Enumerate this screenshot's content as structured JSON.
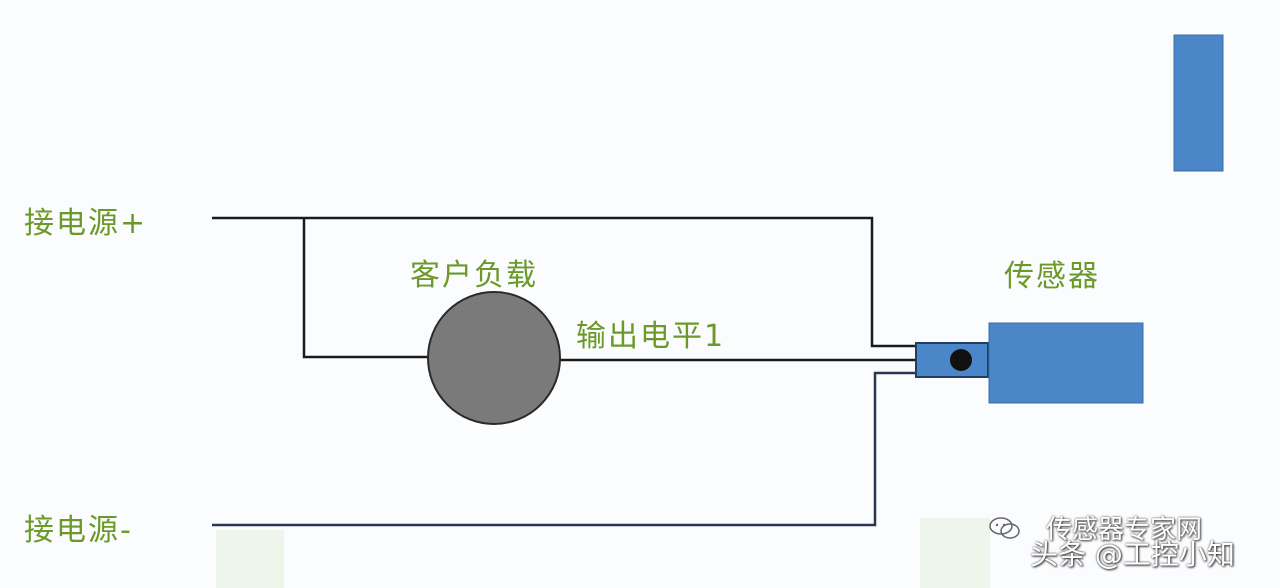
{
  "labels": {
    "power_plus": "接电源+",
    "power_minus": "接电源-",
    "customer_load": "客户负载",
    "output_level": "输出电平1",
    "sensor": "传感器"
  },
  "watermark": {
    "source": "传感器专家网",
    "author": "头条 @工控小知",
    "icon": "wechat-icon"
  },
  "colors": {
    "label_text": "#6b9a2a",
    "wire": "#1a1a1a",
    "wire_blue": "#2d6fb5",
    "sensor_fill": "#4a86c8",
    "sensor_stroke": "#3a6ea8",
    "load_fill": "#7a7a7a",
    "background": "#fbfcfe"
  }
}
